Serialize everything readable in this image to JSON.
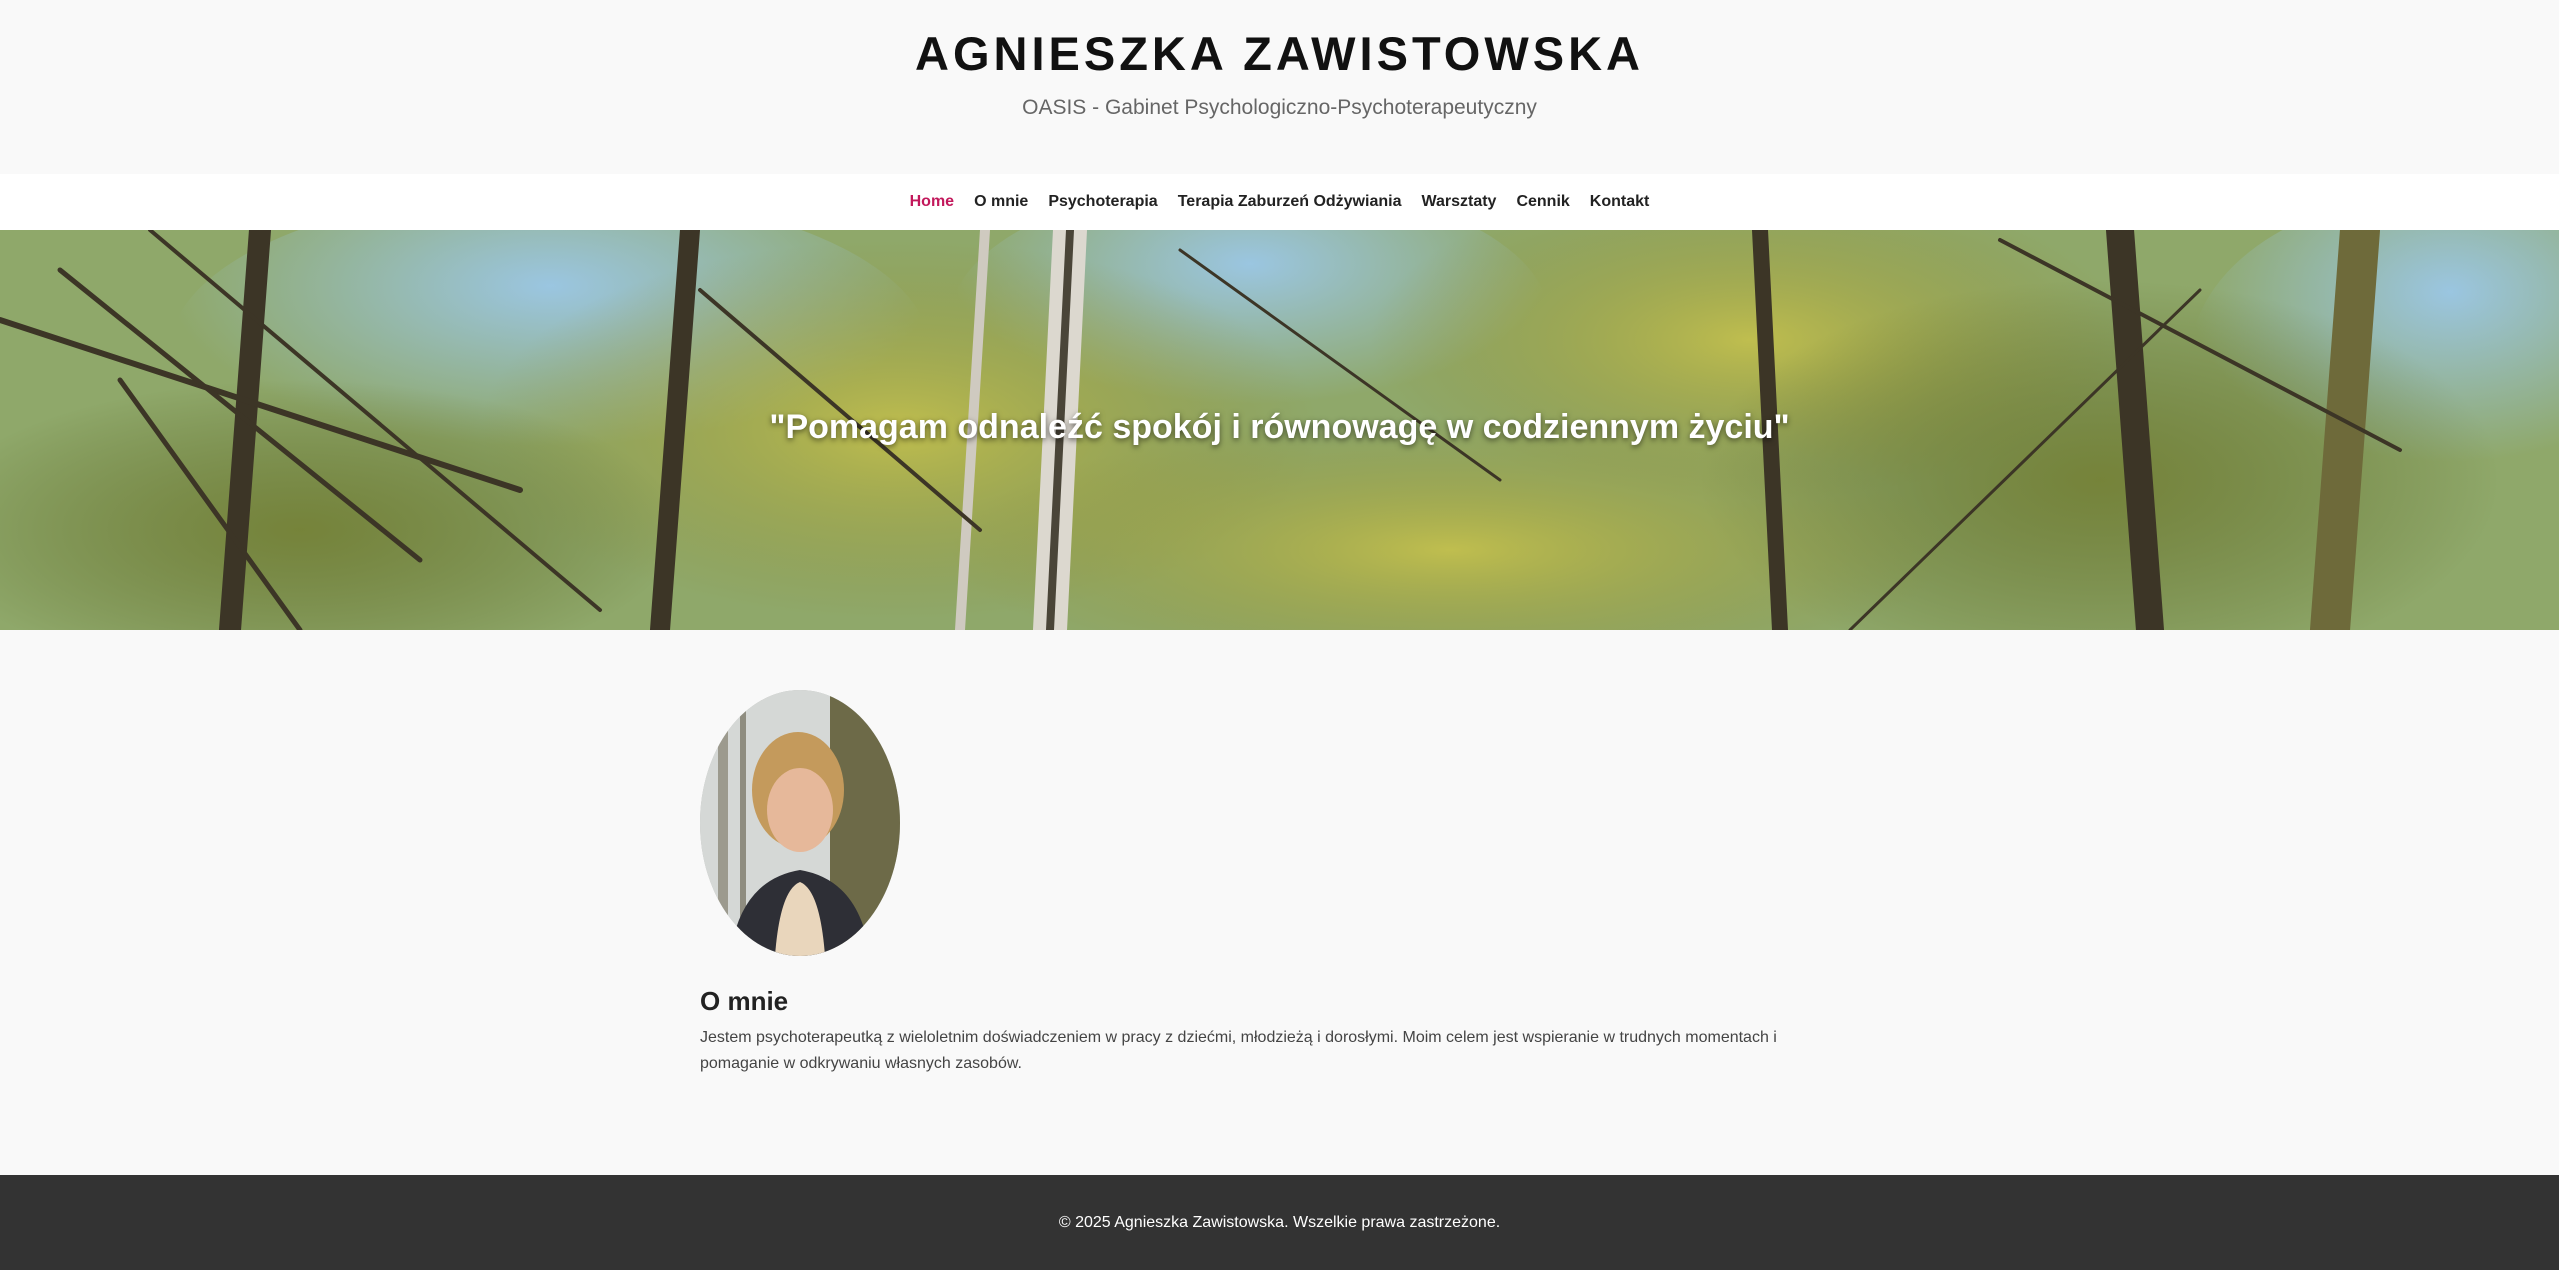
{
  "header": {
    "title": "AGNIESZKA ZAWISTOWSKA",
    "subtitle": "OASIS - Gabinet Psychologiczno-Psychoterapeutyczny"
  },
  "nav": {
    "items": [
      {
        "label": "Home",
        "active": true
      },
      {
        "label": "O mnie"
      },
      {
        "label": "Psychoterapia"
      },
      {
        "label": "Terapia Zaburzeń Odżywiania"
      },
      {
        "label": "Warsztaty"
      },
      {
        "label": "Cennik"
      },
      {
        "label": "Kontakt"
      }
    ],
    "active_color": "#c2185b"
  },
  "hero": {
    "quote": "\"Pomagam odnaleźć spokój i równowagę w codziennym życiu\""
  },
  "about": {
    "heading": "O mnie",
    "text": "Jestem psychoterapeutką z wieloletnim doświadczeniem w pracy z dziećmi, młodzieżą i dorosłymi. Moim celem jest wspieranie w trudnych momentach i pomaganie w odkrywaniu własnych zasobów."
  },
  "footer": {
    "text": "© 2025 Agnieszka Zawistowska. Wszelkie prawa zastrzeżone."
  }
}
